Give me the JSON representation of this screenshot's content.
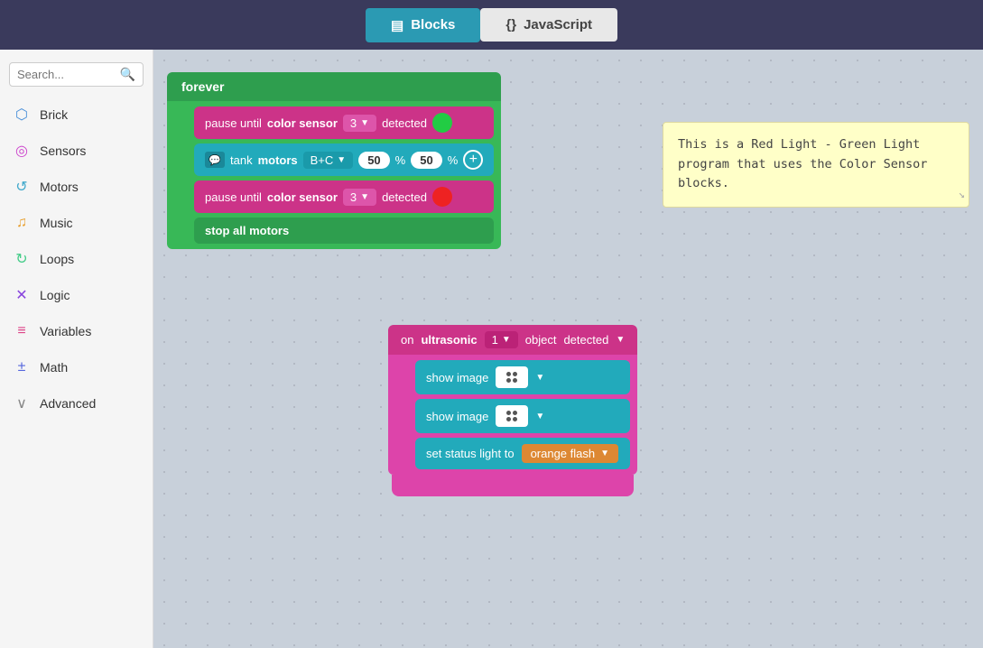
{
  "topbar": {
    "blocks_label": "Blocks",
    "javascript_label": "JavaScript"
  },
  "sidebar": {
    "search_placeholder": "Search...",
    "items": [
      {
        "id": "brick",
        "label": "Brick",
        "icon": "⬡"
      },
      {
        "id": "sensors",
        "label": "Sensors",
        "icon": "◎"
      },
      {
        "id": "motors",
        "label": "Motors",
        "icon": "↺"
      },
      {
        "id": "music",
        "label": "Music",
        "icon": "♫"
      },
      {
        "id": "loops",
        "label": "Loops",
        "icon": "↻"
      },
      {
        "id": "logic",
        "label": "Logic",
        "icon": "✕"
      },
      {
        "id": "variables",
        "label": "Variables",
        "icon": "≡"
      },
      {
        "id": "math",
        "label": "Math",
        "icon": "±"
      },
      {
        "id": "advanced",
        "label": "Advanced",
        "icon": "∨"
      }
    ]
  },
  "forever_block": {
    "header": "forever",
    "pause1_text1": "pause until",
    "pause1_sensor": "color sensor",
    "pause1_port": "3",
    "pause1_text2": "detected",
    "motor_text1": "tank",
    "motor_keyword": "motors",
    "motor_port": "B+C",
    "motor_pct1": "50",
    "motor_pct_label": "%",
    "motor_pct2": "50",
    "motor_pct_label2": "%",
    "pause2_text1": "pause until",
    "pause2_sensor": "color sensor",
    "pause2_port": "3",
    "pause2_text2": "detected",
    "stop_text": "stop all motors"
  },
  "ultrasonic_block": {
    "header_text1": "on",
    "header_keyword": "ultrasonic",
    "header_port": "1",
    "header_text2": "object",
    "header_text3": "detected",
    "show1_text": "show image",
    "show2_text": "show image",
    "status_text1": "set status light to",
    "status_value": "orange flash"
  },
  "note": {
    "text": "This is a Red Light - Green Light\nprogram that uses the Color Sensor\nblocks."
  }
}
